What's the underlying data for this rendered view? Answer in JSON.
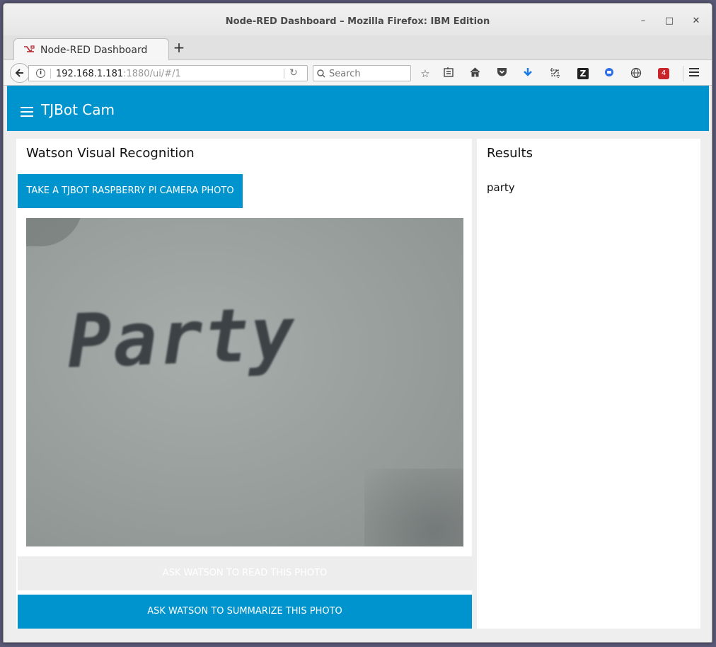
{
  "window": {
    "title": "Node-RED Dashboard – Mozilla Firefox: IBM Edition",
    "minimize_glyph": "–",
    "maximize_glyph": "□",
    "close_glyph": "✕"
  },
  "tabs": [
    {
      "label": "Node-RED Dashboard",
      "icon": "node-red-icon",
      "active": true
    }
  ],
  "newtab_glyph": "+",
  "navbar": {
    "url_host": "192.168.1.181",
    "url_path": ":1880/ui/#/1",
    "search_placeholder": "Search",
    "toolbar_icons": [
      "star-icon",
      "reading-list-icon",
      "home-icon",
      "pocket-icon",
      "download-icon",
      "screenshot-icon",
      "zotero-icon",
      "extension-icon",
      "globe-icon",
      "notification-badge-icon",
      "hamburger-menu-icon"
    ],
    "badge_count": "4",
    "zotero_glyph": "Z"
  },
  "app": {
    "title": "TJBot Cam",
    "header_color": "#0094ce",
    "left_card": {
      "title": "Watson Visual Recognition",
      "take_photo_label": "TAKE A TJBOT RASPBERRY PI CAMERA PHOTO",
      "photo_text": "Party",
      "read_label": "ASK WATSON TO READ THIS PHOTO",
      "summarize_label": "ASK WATSON TO SUMMARIZE THIS PHOTO"
    },
    "right_card": {
      "title": "Results",
      "result": "party"
    }
  }
}
